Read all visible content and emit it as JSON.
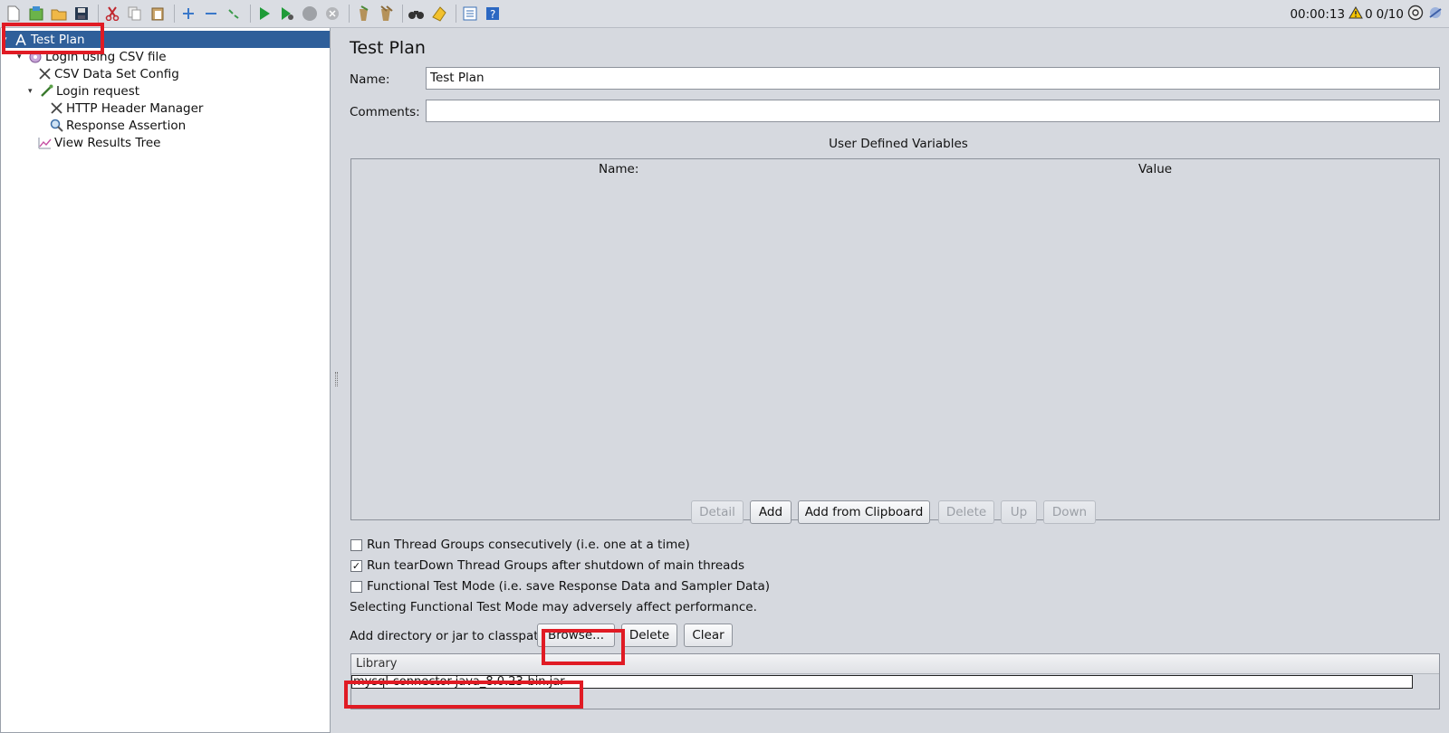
{
  "toolbar": {
    "buttons": [
      "new-icon",
      "templates-icon",
      "open-icon",
      "save-icon",
      "cut-icon",
      "copy-icon",
      "paste-icon",
      "expand-icon",
      "collapse-icon",
      "toggle-icon",
      "start-icon",
      "start-no-pause-icon",
      "stop-icon",
      "shutdown-icon",
      "clear-icon",
      "clear-all-icon",
      "search-icon",
      "reset-search-icon",
      "function-helper-icon",
      "help-icon"
    ],
    "timer": "00:00:13",
    "warnings": "0",
    "threads": "0/10"
  },
  "tree": {
    "items": [
      {
        "label": "Test Plan",
        "icon": "test-plan-icon"
      },
      {
        "label": "Login using CSV file",
        "icon": "thread-group-icon"
      },
      {
        "label": "CSV Data Set Config",
        "icon": "config-element-icon"
      },
      {
        "label": "Login request",
        "icon": "http-sampler-icon"
      },
      {
        "label": "HTTP Header Manager",
        "icon": "config-element-icon"
      },
      {
        "label": "Response Assertion",
        "icon": "assertion-icon"
      },
      {
        "label": "View Results Tree",
        "icon": "listener-icon"
      }
    ]
  },
  "main": {
    "title": "Test Plan",
    "name_label": "Name:",
    "name_value": "Test Plan",
    "comments_label": "Comments:",
    "comments_value": "",
    "udv_title": "User Defined Variables",
    "table_headers": [
      "Name:",
      "Value"
    ],
    "table_buttons": [
      "Detail",
      "Add",
      "Add from Clipboard",
      "Delete",
      "Up",
      "Down"
    ],
    "checkboxes": [
      {
        "label": "Run Thread Groups consecutively (i.e. one at a time)",
        "checked": false
      },
      {
        "label": "Run tearDown Thread Groups after shutdown of main threads",
        "checked": true
      },
      {
        "label": "Functional Test Mode (i.e. save Response Data and Sampler Data)",
        "checked": false
      }
    ],
    "functional_note": "Selecting Functional Test Mode may adversely affect performance.",
    "classpath_label": "Add directory or jar to classpath",
    "classpath_buttons": [
      "Browse...",
      "Delete",
      "Clear"
    ],
    "library_header": "Library",
    "library_rows": [
      "mysql-connector-java_8.0.23-bin.jar"
    ]
  },
  "colors": {
    "highlight_box": "#e01b24",
    "selection": "#2f5f9a"
  }
}
